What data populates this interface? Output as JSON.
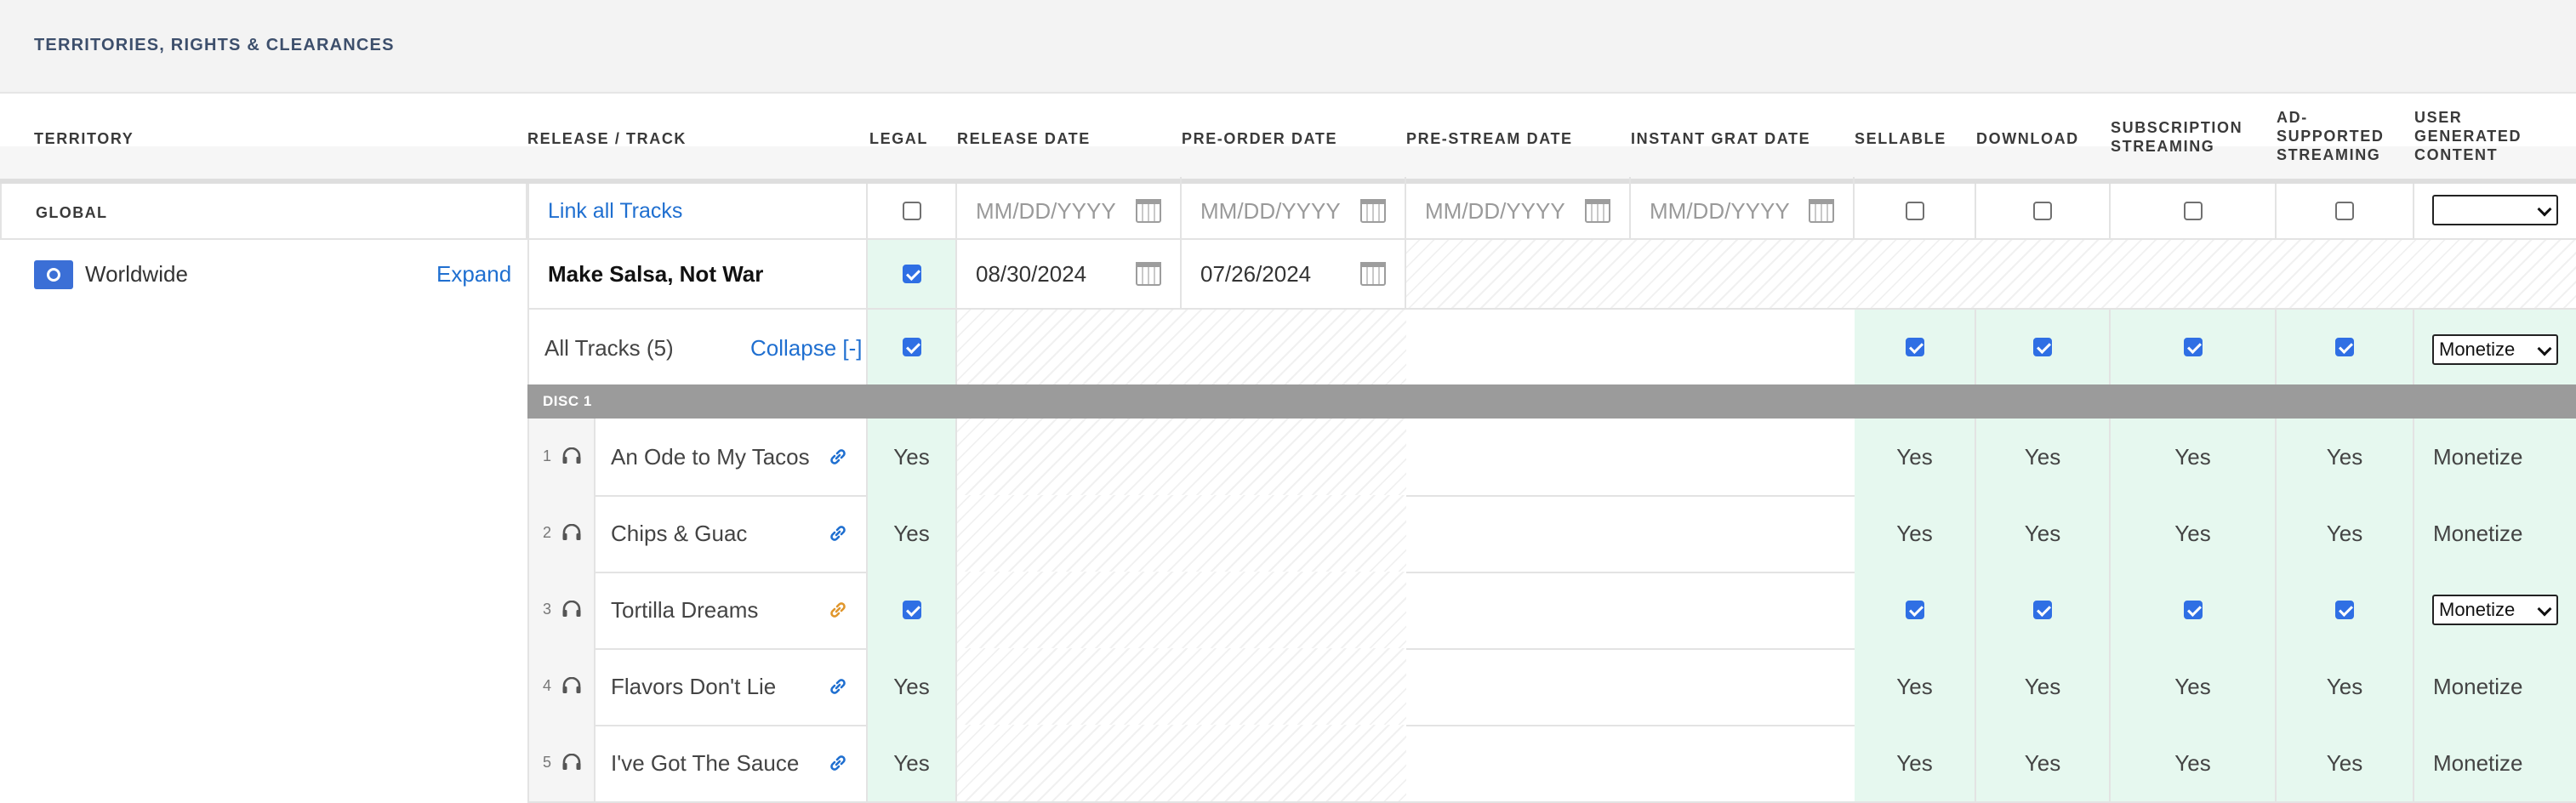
{
  "section_title": "TERRITORIES, RIGHTS & CLEARANCES",
  "columns": {
    "territory": "TERRITORY",
    "release_track": "RELEASE / TRACK",
    "legal": "LEGAL",
    "release_date": "RELEASE DATE",
    "preorder_date": "PRE-ORDER DATE",
    "prestream_date": "PRE-STREAM DATE",
    "instant_grat_date": "INSTANT GRAT DATE",
    "sellable": "SELLABLE",
    "download": "DOWNLOAD",
    "subscription_streaming_1": "SUBSCRIPTION",
    "subscription_streaming_2": "STREAMING",
    "ad_supported_1": "AD-",
    "ad_supported_2": "SUPPORTED",
    "ad_supported_3": "STREAMING",
    "ugc_1": "USER",
    "ugc_2": "GENERATED",
    "ugc_3": "CONTENT"
  },
  "global_row": {
    "label": "GLOBAL",
    "link_all_tracks": "Link all Tracks",
    "date_placeholder": "MM/DD/YYYY",
    "ugc_value": ""
  },
  "territory": {
    "name": "Worldwide",
    "expand": "Expand"
  },
  "release": {
    "title": "Make Salsa, Not War",
    "release_date": "08/30/2024",
    "preorder_date": "07/26/2024"
  },
  "all_tracks": {
    "label": "All Tracks (5)",
    "collapse": "Collapse [-]",
    "ugc_value": "Monetize"
  },
  "disc_label": "DISC 1",
  "yes_label": "Yes",
  "tracks": [
    {
      "num": "1",
      "title": "An Ode to My Tacos",
      "ugc": "Monetize"
    },
    {
      "num": "2",
      "title": "Chips & Guac",
      "ugc": "Monetize"
    },
    {
      "num": "3",
      "title": "Tortilla Dreams",
      "ugc": "Monetize"
    },
    {
      "num": "4",
      "title": "Flavors Don't Lie",
      "ugc": "Monetize"
    },
    {
      "num": "5",
      "title": "I've Got The Sauce",
      "ugc": "Monetize"
    }
  ],
  "colors": {
    "accent_blue": "#2f6fe4",
    "link_blue": "#1f6fd0",
    "mint": "#e6f8ef",
    "unlinked_orange": "#e0962b",
    "disc_bar": "#9b9b9b"
  }
}
